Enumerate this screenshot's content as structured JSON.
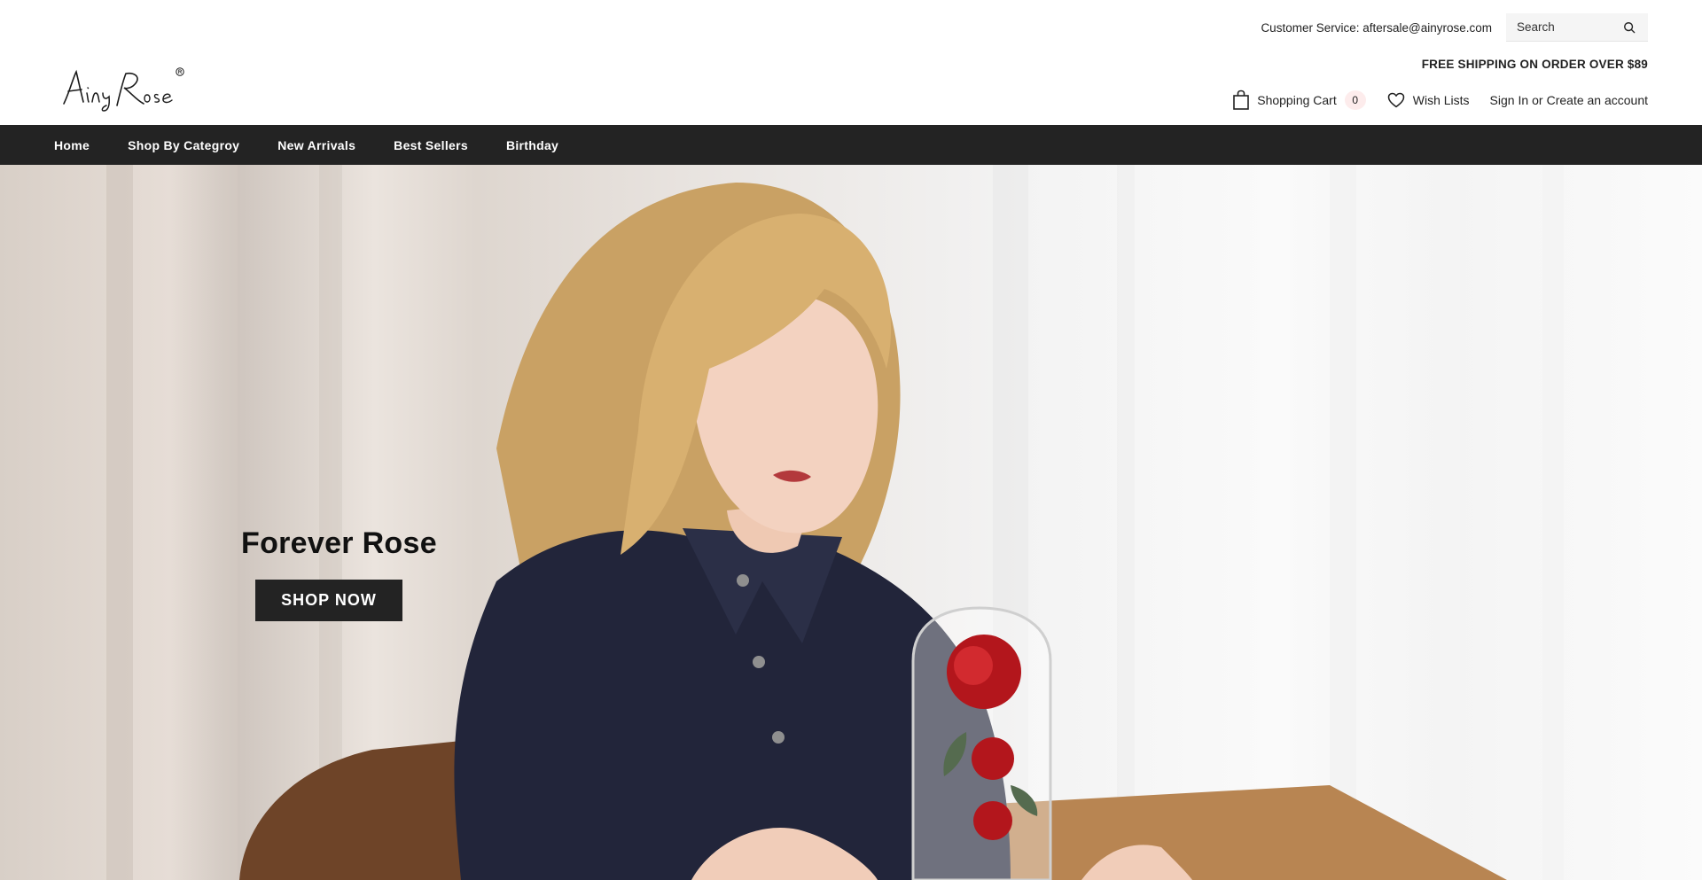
{
  "header": {
    "customer_service": "Customer Service: aftersale@ainyrose.com",
    "search": {
      "placeholder": "Search",
      "icon": "search-icon"
    },
    "logo_text": "AinyRose",
    "free_shipping": "FREE SHIPPING ON ORDER OVER $89",
    "cart": {
      "label": "Shopping Cart",
      "count": "0",
      "icon": "shopping-bag-icon"
    },
    "wishlist": {
      "label": "Wish Lists",
      "icon": "heart-icon"
    },
    "account": {
      "sign_in": "Sign In",
      "or": "or",
      "create": "Create an account"
    }
  },
  "nav": {
    "items": [
      {
        "label": "Home"
      },
      {
        "label": "Shop By Categroy"
      },
      {
        "label": "New Arrivals"
      },
      {
        "label": "Best Sellers"
      },
      {
        "label": "Birthday"
      }
    ]
  },
  "hero": {
    "title": "Forever Rose",
    "button": "SHOP NOW"
  },
  "colors": {
    "nav_bg": "#232323",
    "button_bg": "#232323",
    "cart_badge": "#fdecec",
    "text": "#222222"
  }
}
